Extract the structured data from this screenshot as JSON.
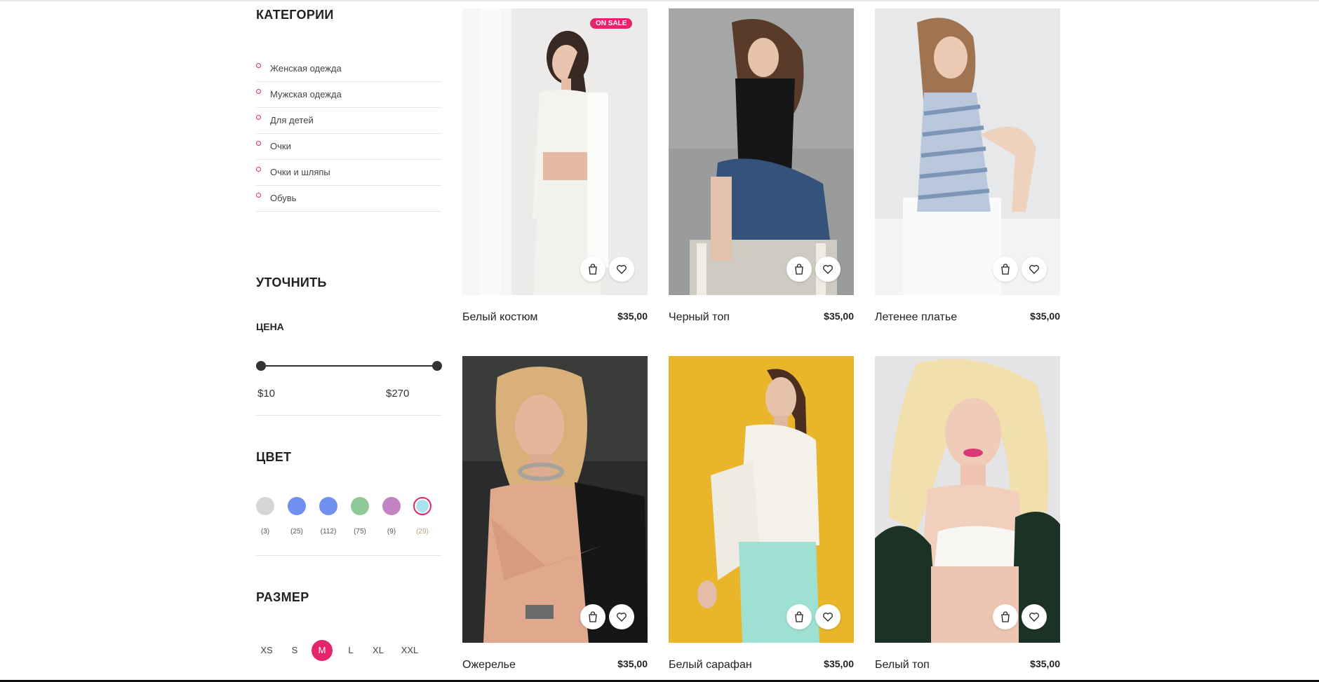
{
  "sidebar": {
    "categories_title": "КАТЕГОРИИ",
    "categories": [
      {
        "label": "Женская одежда"
      },
      {
        "label": "Мужская одежда"
      },
      {
        "label": "Для детей"
      },
      {
        "label": "Очки"
      },
      {
        "label": "Очки и шляпы"
      },
      {
        "label": "Обувь"
      }
    ],
    "refine_title": "УТОЧНИТЬ",
    "price": {
      "title": "ЦЕНА",
      "min": "$10",
      "max": "$270"
    },
    "color": {
      "title": "ЦВЕТ",
      "swatches": [
        {
          "color": "#d6d6d6",
          "count": "(3)"
        },
        {
          "color": "#7090ef",
          "count": "(25)"
        },
        {
          "color": "#7090ef",
          "count": "(112)"
        },
        {
          "color": "#8fc99a",
          "count": "(75)"
        },
        {
          "color": "#c283c3",
          "count": "(9)"
        },
        {
          "color": "#a9e3ef",
          "count": "(29)",
          "selected": true
        }
      ]
    },
    "size": {
      "title": "РАЗМЕР",
      "options": [
        "XS",
        "S",
        "M",
        "L",
        "XL",
        "XXL"
      ],
      "selected": "M"
    }
  },
  "products": [
    {
      "name": "Белый костюм",
      "price": "$35,00",
      "badge": "ON SALE"
    },
    {
      "name": "Черный топ",
      "price": "$35,00"
    },
    {
      "name": "Летенее платье",
      "price": "$35,00"
    },
    {
      "name": "Ожерелье",
      "price": "$35,00"
    },
    {
      "name": "Белый сарафан",
      "price": "$35,00"
    },
    {
      "name": "Белый топ",
      "price": "$35,00"
    }
  ],
  "colors": {
    "accent": "#e5256b",
    "text": "#222222",
    "divider": "#e3e3e3"
  }
}
